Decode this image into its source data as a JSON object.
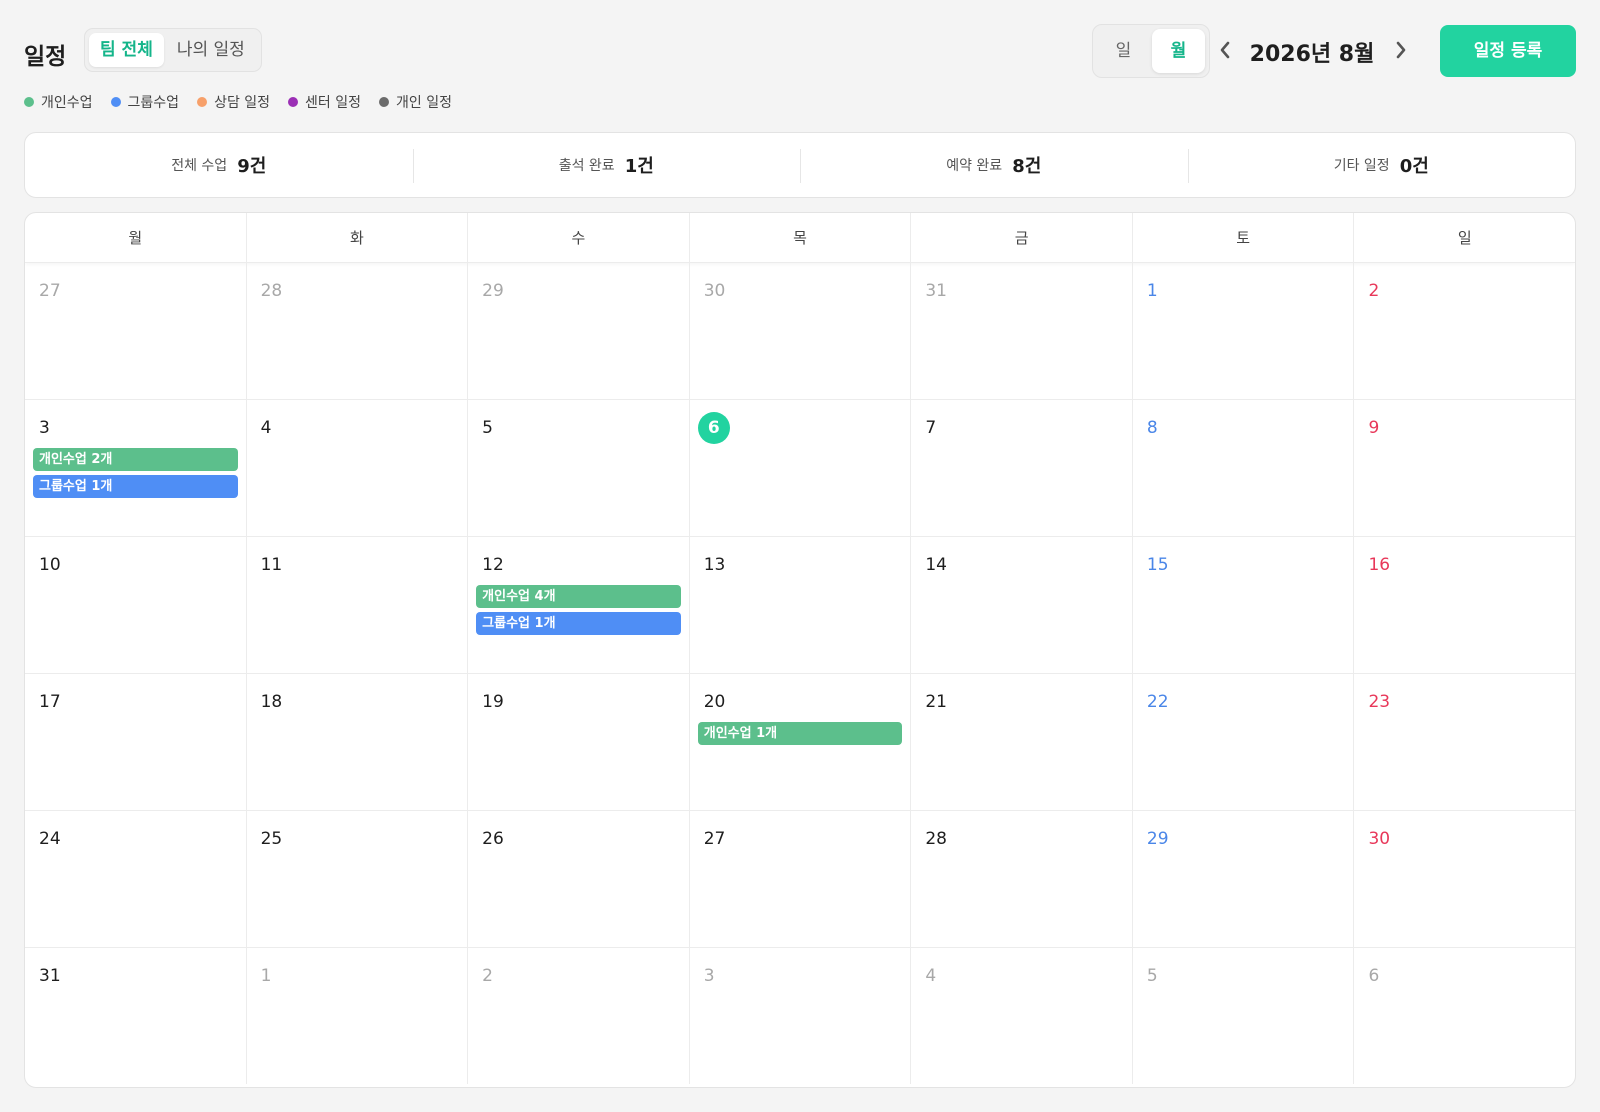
{
  "header": {
    "title": "일정",
    "scope_tabs": [
      {
        "label": "팀 전체",
        "active": true
      },
      {
        "label": "나의 일정",
        "active": false
      }
    ],
    "view_modes": [
      {
        "label": "일",
        "active": false
      },
      {
        "label": "월",
        "active": true
      }
    ],
    "month_label": "2026년 8월",
    "add_button_label": "일정 등록"
  },
  "legend": [
    {
      "label": "개인수업",
      "color": "#5cbf8c"
    },
    {
      "label": "그룹수업",
      "color": "#4f8ef5"
    },
    {
      "label": "상담 일정",
      "color": "#f7a06a"
    },
    {
      "label": "센터 일정",
      "color": "#9b2fb5"
    },
    {
      "label": "개인 일정",
      "color": "#6b6b6b"
    }
  ],
  "stats": [
    {
      "label": "전체 수업",
      "value": "9건"
    },
    {
      "label": "출석 완료",
      "value": "1건"
    },
    {
      "label": "예약 완료",
      "value": "8건"
    },
    {
      "label": "기타 일정",
      "value": "0건"
    }
  ],
  "weekdays": [
    "월",
    "화",
    "수",
    "목",
    "금",
    "토",
    "일"
  ],
  "weeks": [
    [
      {
        "day": "27",
        "muted": true
      },
      {
        "day": "28",
        "muted": true
      },
      {
        "day": "29",
        "muted": true
      },
      {
        "day": "30",
        "muted": true
      },
      {
        "day": "31",
        "muted": true
      },
      {
        "day": "1",
        "kind": "sat"
      },
      {
        "day": "2",
        "kind": "sun"
      }
    ],
    [
      {
        "day": "3",
        "events": [
          {
            "label": "개인수업 2개",
            "type": "personal"
          },
          {
            "label": "그룹수업 1개",
            "type": "group"
          }
        ]
      },
      {
        "day": "4"
      },
      {
        "day": "5"
      },
      {
        "day": "6",
        "today": true
      },
      {
        "day": "7"
      },
      {
        "day": "8",
        "kind": "sat"
      },
      {
        "day": "9",
        "kind": "sun"
      }
    ],
    [
      {
        "day": "10"
      },
      {
        "day": "11"
      },
      {
        "day": "12",
        "events": [
          {
            "label": "개인수업 4개",
            "type": "personal"
          },
          {
            "label": "그룹수업 1개",
            "type": "group"
          }
        ]
      },
      {
        "day": "13"
      },
      {
        "day": "14"
      },
      {
        "day": "15",
        "kind": "sat"
      },
      {
        "day": "16",
        "kind": "sun"
      }
    ],
    [
      {
        "day": "17"
      },
      {
        "day": "18"
      },
      {
        "day": "19"
      },
      {
        "day": "20",
        "events": [
          {
            "label": "개인수업 1개",
            "type": "personal"
          }
        ]
      },
      {
        "day": "21"
      },
      {
        "day": "22",
        "kind": "sat"
      },
      {
        "day": "23",
        "kind": "sun"
      }
    ],
    [
      {
        "day": "24"
      },
      {
        "day": "25"
      },
      {
        "day": "26"
      },
      {
        "day": "27"
      },
      {
        "day": "28"
      },
      {
        "day": "29",
        "kind": "sat"
      },
      {
        "day": "30",
        "kind": "sun"
      }
    ],
    [
      {
        "day": "31"
      },
      {
        "day": "1",
        "muted": true
      },
      {
        "day": "2",
        "muted": true
      },
      {
        "day": "3",
        "muted": true
      },
      {
        "day": "4",
        "muted": true
      },
      {
        "day": "5",
        "muted": true
      },
      {
        "day": "6",
        "muted": true
      }
    ]
  ],
  "colors": {
    "accent": "#22d3a0",
    "accent_text": "#14b58a",
    "saturday": "#4a86e8",
    "sunday": "#e8385a"
  },
  "icons": {
    "prev": "chevron-left-icon",
    "next": "chevron-right-icon"
  }
}
